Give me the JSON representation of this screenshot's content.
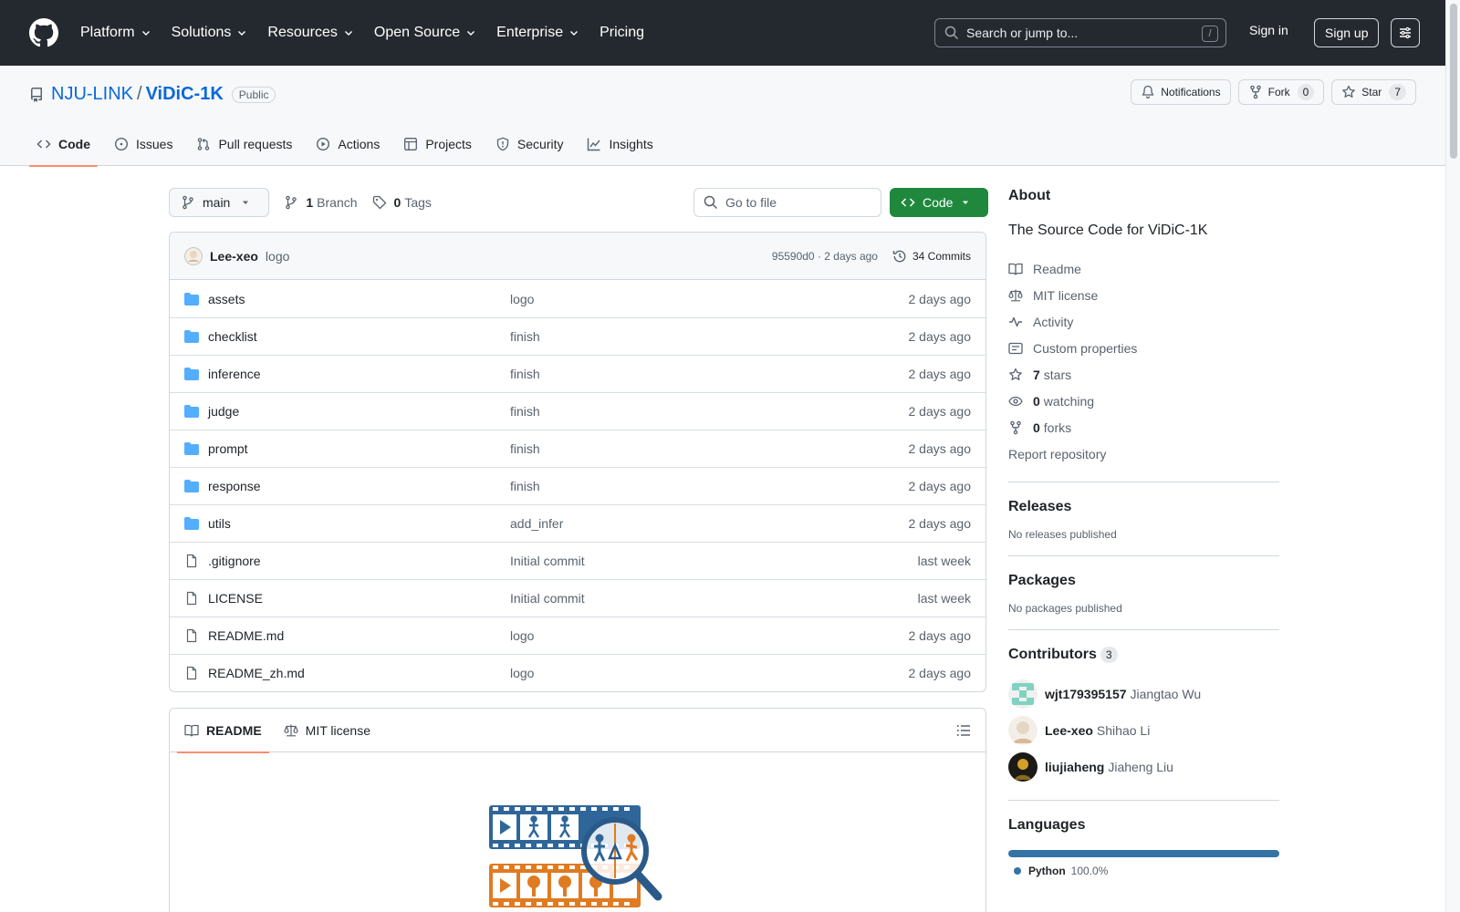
{
  "header": {
    "nav": [
      "Platform",
      "Solutions",
      "Resources",
      "Open Source",
      "Enterprise"
    ],
    "pricing": "Pricing",
    "search_placeholder": "Search or jump to...",
    "search_shortcut": "/",
    "sign_in": "Sign in",
    "sign_up": "Sign up"
  },
  "repo": {
    "owner": "NJU-LINK",
    "separator": "/",
    "name": "ViDiC-1K",
    "visibility": "Public",
    "actions": {
      "notifications": "Notifications",
      "fork": "Fork",
      "fork_count": "0",
      "star": "Star",
      "star_count": "7"
    },
    "tabs": [
      "Code",
      "Issues",
      "Pull requests",
      "Actions",
      "Projects",
      "Security",
      "Insights"
    ],
    "selected_tab": "Code"
  },
  "toolbar": {
    "branch": "main",
    "branch_count": "1",
    "branch_label": "Branch",
    "tag_count": "0",
    "tag_label": "Tags",
    "goto_placeholder": "Go to file",
    "code_button": "Code"
  },
  "latest_commit": {
    "author": "Lee-xeo",
    "message": "logo",
    "hash_time": "95590d0 · 2 days ago",
    "commits": "34 Commits"
  },
  "files": [
    {
      "type": "dir",
      "name": "assets",
      "message": "logo",
      "time": "2 days ago"
    },
    {
      "type": "dir",
      "name": "checklist",
      "message": "finish",
      "time": "2 days ago"
    },
    {
      "type": "dir",
      "name": "inference",
      "message": "finish",
      "time": "2 days ago"
    },
    {
      "type": "dir",
      "name": "judge",
      "message": "finish",
      "time": "2 days ago"
    },
    {
      "type": "dir",
      "name": "prompt",
      "message": "finish",
      "time": "2 days ago"
    },
    {
      "type": "dir",
      "name": "response",
      "message": "finish",
      "time": "2 days ago"
    },
    {
      "type": "dir",
      "name": "utils",
      "message": "add_infer",
      "time": "2 days ago"
    },
    {
      "type": "file",
      "name": ".gitignore",
      "message": "Initial commit",
      "time": "last week"
    },
    {
      "type": "file",
      "name": "LICENSE",
      "message": "Initial commit",
      "time": "last week"
    },
    {
      "type": "file",
      "name": "README.md",
      "message": "logo",
      "time": "2 days ago"
    },
    {
      "type": "file",
      "name": "README_zh.md",
      "message": "logo",
      "time": "2 days ago"
    }
  ],
  "readme": {
    "tabs": [
      "README",
      "MIT license"
    ]
  },
  "about": {
    "title": "About",
    "description": "The Source Code for ViDiC-1K",
    "links": {
      "readme": "Readme",
      "license": "MIT license",
      "activity": "Activity",
      "custom_properties": "Custom properties",
      "stars_count": "7",
      "stars_label": "stars",
      "watching_count": "0",
      "watching_label": "watching",
      "forks_count": "0",
      "forks_label": "forks",
      "report": "Report repository"
    }
  },
  "releases": {
    "title": "Releases",
    "note": "No releases published"
  },
  "packages": {
    "title": "Packages",
    "note": "No packages published"
  },
  "contributors": {
    "title": "Contributors",
    "count": "3",
    "list": [
      {
        "login": "wjt179395157",
        "name": "Jiangtao Wu"
      },
      {
        "login": "Lee-xeo",
        "name": "Shihao Li"
      },
      {
        "login": "liujiaheng",
        "name": "Jiaheng Liu"
      }
    ]
  },
  "languages": {
    "title": "Languages",
    "items": [
      {
        "name": "Python",
        "percent": "100.0%",
        "fraction": 1.0,
        "color": "#3572A5"
      }
    ]
  },
  "colors": {
    "header_bg": "#24292f",
    "link": "#0969da",
    "primary_button": "#1f883d",
    "tab_underline": "#fd8c73",
    "folder": "#54aeff"
  }
}
